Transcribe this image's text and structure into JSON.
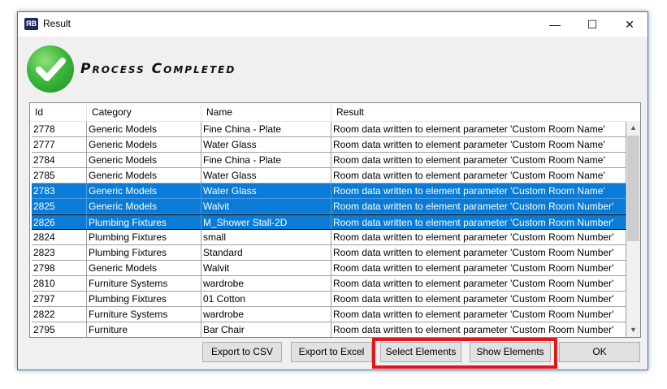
{
  "window": {
    "title": "Result",
    "app_icon_text": "ЯB",
    "minimize": "—",
    "maximize": "☐",
    "close": "✕"
  },
  "header": {
    "title": "Process Completed"
  },
  "table": {
    "columns": [
      "Id",
      "Category",
      "Name",
      "Result"
    ],
    "rows": [
      {
        "id": "2778",
        "category": "Generic Models",
        "name": "Fine China - Plate",
        "result": "Room data written to element parameter 'Custom Room Name'",
        "selected": false
      },
      {
        "id": "2777",
        "category": "Generic Models",
        "name": "Water Glass",
        "result": "Room data written to element parameter 'Custom Room Name'",
        "selected": false
      },
      {
        "id": "2784",
        "category": "Generic Models",
        "name": "Fine China - Plate",
        "result": "Room data written to element parameter 'Custom Room Name'",
        "selected": false
      },
      {
        "id": "2785",
        "category": "Generic Models",
        "name": "Water Glass",
        "result": "Room data written to element parameter 'Custom Room Name'",
        "selected": false
      },
      {
        "id": "2783",
        "category": "Generic Models",
        "name": "Water Glass",
        "result": "Room data written to element parameter 'Custom Room Name'",
        "selected": true
      },
      {
        "id": "2825",
        "category": "Generic Models",
        "name": "Walvit",
        "result": "Room data written to element parameter 'Custom Room Number'",
        "selected": true
      },
      {
        "id": "2826",
        "category": "Plumbing Fixtures",
        "name": "M_Shower Stall-2D",
        "result": "Room data written to element parameter 'Custom Room Number'",
        "selected": true,
        "focused": true
      },
      {
        "id": "2824",
        "category": "Plumbing Fixtures",
        "name": "small",
        "result": "Room data written to element parameter 'Custom Room Number'",
        "selected": false
      },
      {
        "id": "2823",
        "category": "Plumbing Fixtures",
        "name": "Standard",
        "result": "Room data written to element parameter 'Custom Room Number'",
        "selected": false
      },
      {
        "id": "2798",
        "category": "Generic Models",
        "name": "Walvit",
        "result": "Room data written to element parameter 'Custom Room Number'",
        "selected": false
      },
      {
        "id": "2810",
        "category": "Furniture Systems",
        "name": "wardrobe",
        "result": "Room data written to element parameter 'Custom Room Number'",
        "selected": false
      },
      {
        "id": "2797",
        "category": "Plumbing Fixtures",
        "name": "01 Cotton",
        "result": "Room data written to element parameter 'Custom Room Number'",
        "selected": false
      },
      {
        "id": "2822",
        "category": "Furniture Systems",
        "name": "wardrobe",
        "result": "Room data written to element parameter 'Custom Room Number'",
        "selected": false
      },
      {
        "id": "2795",
        "category": "Furniture",
        "name": "Bar Chair",
        "result": "Room data written to element parameter 'Custom Room Number'",
        "selected": false
      }
    ]
  },
  "buttons": {
    "export_csv": "Export to CSV",
    "export_excel": "Export to Excel",
    "select_elements": "Select Elements",
    "show_elements": "Show Elements",
    "ok": "OK"
  },
  "colors": {
    "selection": "#0a7bd6",
    "highlight": "#e0161b",
    "accent": "#2b79d0"
  }
}
